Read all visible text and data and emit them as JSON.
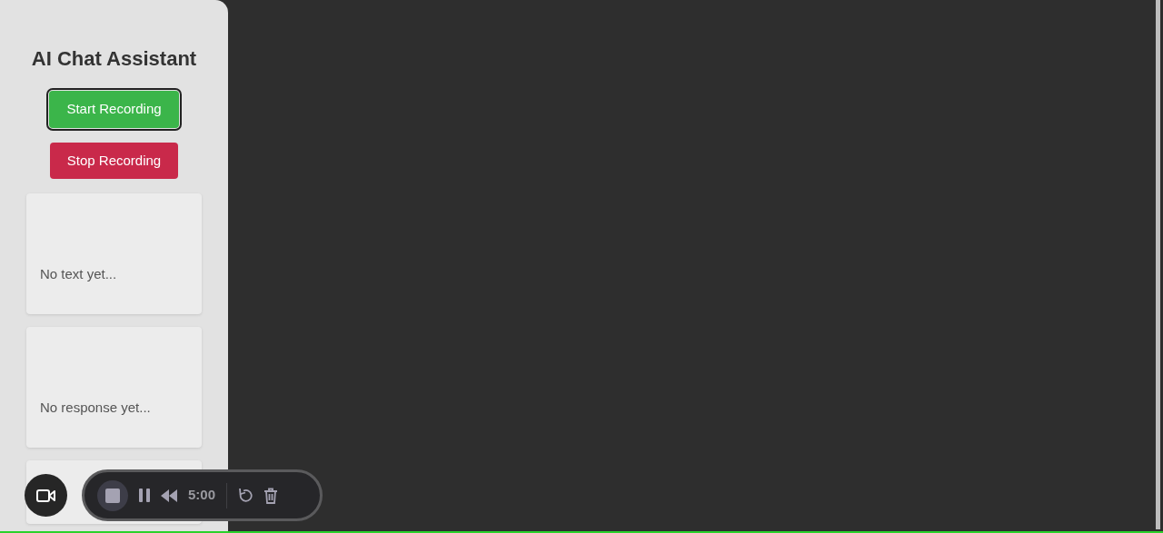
{
  "sidebar": {
    "title": "AI Chat Assistant",
    "buttons": [
      {
        "label": "Start Recording",
        "kind": "start",
        "focused": true
      },
      {
        "label": "Stop Recording",
        "kind": "stop",
        "focused": false
      }
    ],
    "cards": [
      {
        "text": "No text yet..."
      },
      {
        "text": "No response yet..."
      }
    ]
  },
  "recorder": {
    "time": "5:00"
  }
}
